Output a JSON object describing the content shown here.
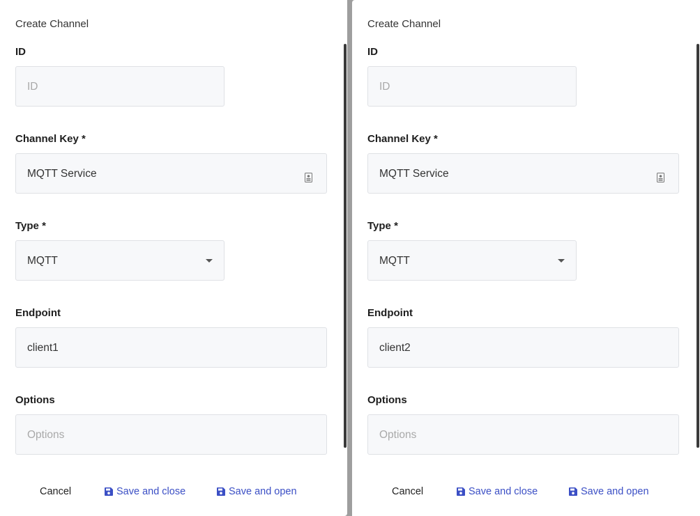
{
  "dialogs": [
    {
      "title": "Create Channel",
      "fields": {
        "id": {
          "label": "ID",
          "value": "",
          "placeholder": "ID"
        },
        "channel_key": {
          "label": "Channel Key *",
          "value": "MQTT Service"
        },
        "type": {
          "label": "Type *",
          "value": "MQTT"
        },
        "endpoint": {
          "label": "Endpoint",
          "value": "client1"
        },
        "options": {
          "label": "Options",
          "value": "",
          "placeholder": "Options"
        }
      },
      "buttons": {
        "cancel": "Cancel",
        "save_close": "Save and close",
        "save_open": "Save and open"
      }
    },
    {
      "title": "Create Channel",
      "fields": {
        "id": {
          "label": "ID",
          "value": "",
          "placeholder": "ID"
        },
        "channel_key": {
          "label": "Channel Key *",
          "value": "MQTT Service"
        },
        "type": {
          "label": "Type *",
          "value": "MQTT"
        },
        "endpoint": {
          "label": "Endpoint",
          "value": "client2"
        },
        "options": {
          "label": "Options",
          "value": "",
          "placeholder": "Options"
        }
      },
      "buttons": {
        "cancel": "Cancel",
        "save_close": "Save and close",
        "save_open": "Save and open"
      }
    }
  ],
  "colors": {
    "backdrop": "#9e9e9e",
    "field_background": "#f7f8fa",
    "accent": "#3b4fc5",
    "label_text": "#1e1e1e"
  },
  "icons": {
    "key_icon": "contact-card-icon",
    "select_icon": "chevron-down-icon",
    "save_icon": "floppy-disk-icon"
  }
}
